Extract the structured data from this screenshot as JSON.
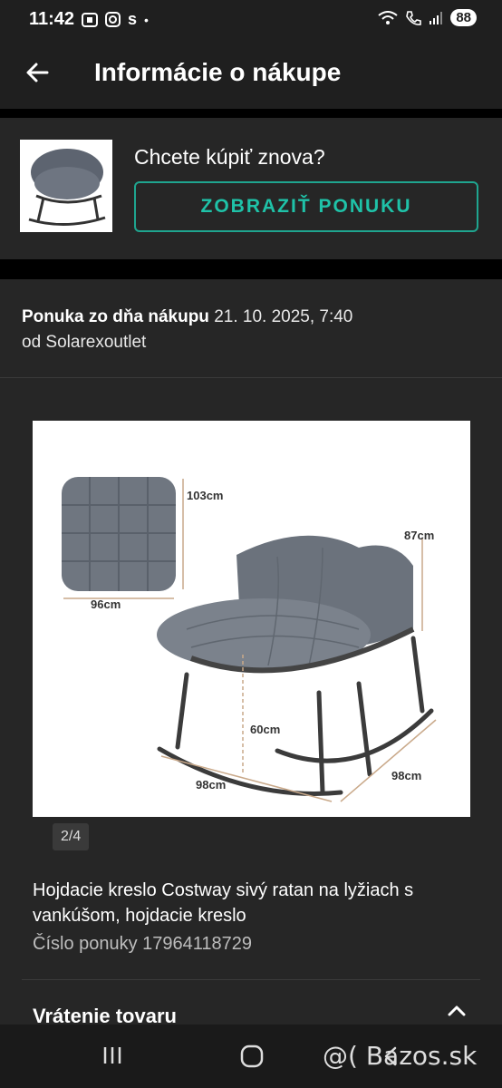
{
  "status_bar": {
    "time": "11:42",
    "left_icons": [
      "notification-icon",
      "instagram-icon",
      "app-icon",
      "dot-icon"
    ],
    "app_text": "s",
    "battery": "88"
  },
  "header": {
    "title": "Informácie o nákupe"
  },
  "rebuy": {
    "question": "Chcete kúpiť znova?",
    "button_label": "ZOBRAZIŤ PONUKU"
  },
  "offer": {
    "offer_label": "Ponuka zo dňa nákupu",
    "offer_date": "21. 10. 2025, 7:40",
    "seller_line": "od Solarexoutlet",
    "image_counter": "2/4",
    "product_title": "Hojdacie kreslo Costway sivý ratan na lyžiach s vankúšom, hojdacie kreslo",
    "offer_number": "Číslo ponuky 17964118729",
    "returns_title": "Vrátenie tovaru"
  },
  "product_image": {
    "dim_cushion_height": "103cm",
    "dim_cushion_width": "96cm",
    "dim_chair_height": "87cm",
    "dim_seat_height": "60cm",
    "dim_width": "98cm",
    "dim_depth": "98cm"
  },
  "watermark": "@( Bazos.sk",
  "colors": {
    "accent": "#1fc2a8",
    "panel": "#262626",
    "bar": "#1f1f1f"
  }
}
